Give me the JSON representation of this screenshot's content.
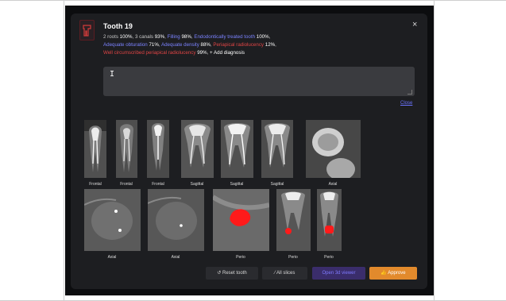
{
  "title": "Tooth 19",
  "close_glyph": "×",
  "diagnoses": {
    "roots_label": "2 roots",
    "roots_pct": "100%",
    "canals_label": "3 canals",
    "canals_pct": "93%",
    "filling_label": "Filling",
    "filling_pct": "98%",
    "endo_label": "Endodontically treated tooth",
    "endo_pct": "100%",
    "obturation_label": "Adequate obturation",
    "obturation_pct": "71%",
    "density_label": "Adequate density",
    "density_pct": "88%",
    "periapical_label": "Periapical radiolucency",
    "periapical_pct": "12%",
    "welldef_label": "Well circumscribed periapical radiolucency",
    "welldef_pct": "99%",
    "add_label": "+ Add diagnosis"
  },
  "comment": {
    "caret": "I",
    "close_link": "Close"
  },
  "slices_row1": [
    "Frontal",
    "Frontal",
    "Frontal",
    "Sagittal",
    "Sagittal",
    "Sagittal",
    "Axial"
  ],
  "slices_row2": [
    "Axial",
    "Axial",
    "Perio",
    "Perio",
    "Perio"
  ],
  "buttons": {
    "reset": "Reset tooth",
    "all_slices": "All slices",
    "open3d": "Open 3d viewer",
    "approve": "Approve"
  },
  "colors": {
    "accent_blue": "#7b83ff",
    "accent_red": "#e04545",
    "approve_orange": "#e28a2c"
  }
}
